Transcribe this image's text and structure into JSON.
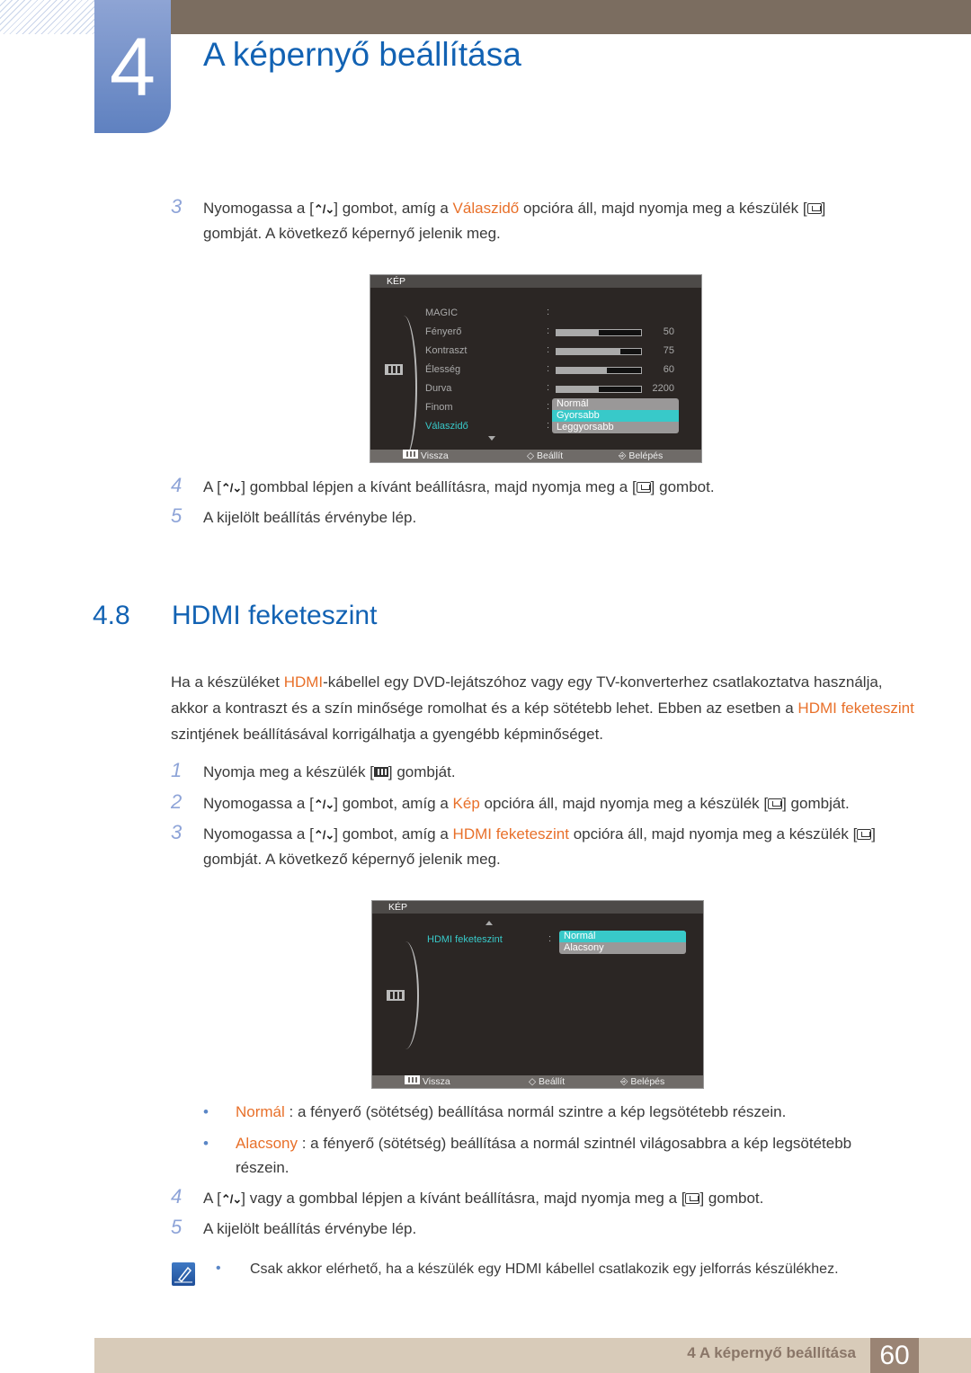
{
  "header": {
    "chapter_number": "4",
    "chapter_title": "A képernyő beállítása"
  },
  "steps_a": [
    {
      "n": "3",
      "segs": [
        {
          "t": "Nyomogassa a ["
        },
        {
          "icon": "updown"
        },
        {
          "t": "] gombot, amíg a "
        },
        {
          "t": "Válaszidő",
          "hl": true
        },
        {
          "t": " opcióra áll, majd nyomja meg a készülék ["
        },
        {
          "icon": "enter"
        },
        {
          "t": "] gombját. A következő képernyő jelenik meg."
        }
      ]
    },
    {
      "n": "4",
      "segs": [
        {
          "t": "A ["
        },
        {
          "icon": "updown"
        },
        {
          "t": "] gombbal lépjen a kívánt beállításra, majd nyomja meg a ["
        },
        {
          "icon": "enter"
        },
        {
          "t": "] gombot."
        }
      ]
    },
    {
      "n": "5",
      "segs": [
        {
          "t": "A kijelölt beállítás érvénybe lép."
        }
      ]
    }
  ],
  "osd1": {
    "header": "KÉP",
    "items": [
      "MAGIC",
      "Fényerő",
      "Kontraszt",
      "Élesség",
      "Durva",
      "Finom",
      "Válaszidő"
    ],
    "bars": [
      {
        "value": "50",
        "fill": 0.5
      },
      {
        "value": "75",
        "fill": 0.75
      },
      {
        "value": "60",
        "fill": 0.6
      },
      {
        "value": "2200",
        "fill": 0.5
      }
    ],
    "options": [
      "Normál",
      "Gyorsabb",
      "Leggyorsabb"
    ],
    "selected": 1,
    "footer": {
      "back": "Vissza",
      "adjust": "Beállít",
      "enter": "Belépés"
    }
  },
  "section": {
    "number": "4.8",
    "title": "HDMI feketeszint"
  },
  "intro": [
    {
      "t": "Ha a készüléket "
    },
    {
      "t": "HDMI",
      "hl": true
    },
    {
      "t": "-kábellel egy DVD-lejátszóhoz vagy egy TV-konverterhez csatlakoztatva használja, akkor a kontraszt és a szín minősége romolhat és a kép sötétebb lehet. Ebben az esetben a "
    },
    {
      "t": "HDMI feketeszint",
      "hl": true
    },
    {
      "t": " szintjének beállításával korrigálhatja a gyengébb képminőséget."
    }
  ],
  "steps_b": [
    {
      "n": "1",
      "segs": [
        {
          "t": "Nyomja meg a készülék ["
        },
        {
          "icon": "menu"
        },
        {
          "t": "] gombját."
        }
      ]
    },
    {
      "n": "2",
      "segs": [
        {
          "t": "Nyomogassa a ["
        },
        {
          "icon": "updown"
        },
        {
          "t": "] gombot, amíg a "
        },
        {
          "t": "Kép",
          "hl": true
        },
        {
          "t": " opcióra áll, majd nyomja meg a készülék ["
        },
        {
          "icon": "enter"
        },
        {
          "t": "] gombját."
        }
      ]
    },
    {
      "n": "3",
      "segs": [
        {
          "t": "Nyomogassa a ["
        },
        {
          "icon": "updown"
        },
        {
          "t": "] gombot, amíg a "
        },
        {
          "t": "HDMI feketeszint",
          "hl": true
        },
        {
          "t": " opcióra áll, majd nyomja meg a készülék ["
        },
        {
          "icon": "enter"
        },
        {
          "t": "] gombját. A következő képernyő jelenik meg."
        }
      ]
    }
  ],
  "osd2": {
    "header": "KÉP",
    "item": "HDMI feketeszint",
    "options": [
      "Normál",
      "Alacsony"
    ],
    "selected": 0,
    "footer": {
      "back": "Vissza",
      "adjust": "Beállít",
      "enter": "Belépés"
    }
  },
  "bullets": [
    [
      {
        "t": "Normál",
        "hl": true
      },
      {
        "t": " : a fényerő (sötétség) beállítása normál szintre a kép legsötétebb részein."
      }
    ],
    [
      {
        "t": "Alacsony",
        "hl": true
      },
      {
        "t": " : a fényerő (sötétség) beállítása a normál szintnél világosabbra a kép legsötétebb részein."
      }
    ]
  ],
  "steps_c": [
    {
      "n": "4",
      "segs": [
        {
          "t": "A ["
        },
        {
          "icon": "updown"
        },
        {
          "t": "] vagy a gombbal lépjen a kívánt beállításra, majd nyomja meg a ["
        },
        {
          "icon": "enter"
        },
        {
          "t": "] gombot."
        }
      ]
    },
    {
      "n": "5",
      "segs": [
        {
          "t": "A kijelölt beállítás érvénybe lép."
        }
      ]
    }
  ],
  "note": "Csak akkor elérhető, ha a készülék egy HDMI kábellel csatlakozik egy jelforrás készülékhez.",
  "footer": {
    "label": "4 A képernyő beállítása",
    "page": "60"
  }
}
